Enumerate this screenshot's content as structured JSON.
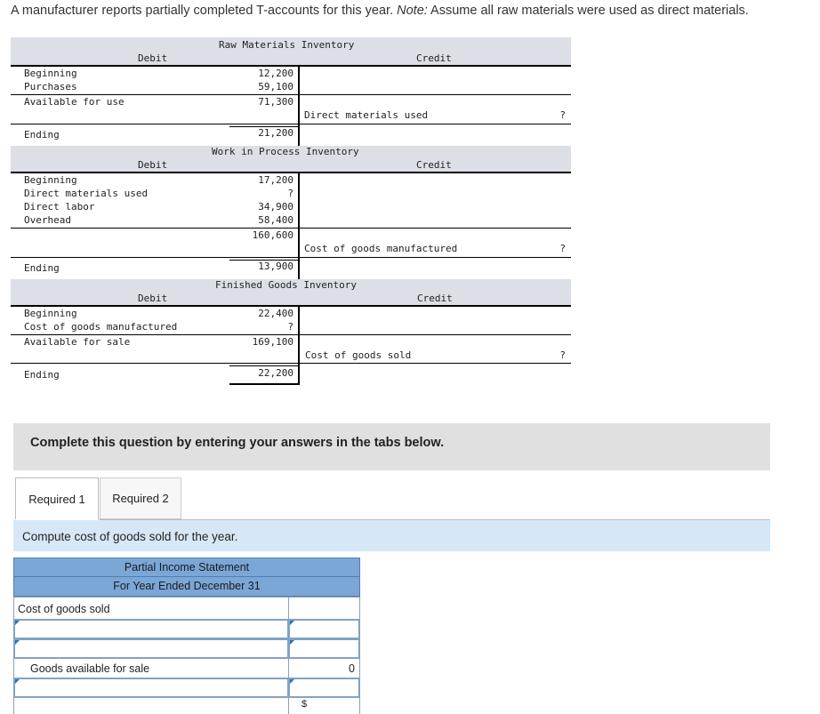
{
  "intro": {
    "text": "A manufacturer reports partially completed T-accounts for this year.",
    "note_label": "Note:",
    "note_text": "Assume all raw materials were used as direct materials."
  },
  "raw_materials": {
    "title": "Raw Materials Inventory",
    "debit_label": "Debit",
    "credit_label": "Credit",
    "rows": [
      {
        "label": "Beginning",
        "value": "12,200"
      },
      {
        "label": "Purchases",
        "value": "59,100"
      },
      {
        "label": "Available for use",
        "value": "71,300"
      }
    ],
    "credit_entry": {
      "label": "Direct materials used",
      "value": "?"
    },
    "ending": {
      "label": "Ending",
      "value": "21,200"
    }
  },
  "work_in_process": {
    "title": "Work in Process Inventory",
    "debit_label": "Debit",
    "credit_label": "Credit",
    "rows": [
      {
        "label": "Beginning",
        "value": "17,200"
      },
      {
        "label": "Direct materials used",
        "value": "?"
      },
      {
        "label": "Direct labor",
        "value": "34,900"
      },
      {
        "label": "Overhead",
        "value": "58,400"
      }
    ],
    "total": "160,600",
    "credit_entry": {
      "label": "Cost of goods manufactured",
      "value": "?"
    },
    "ending": {
      "label": "Ending",
      "value": "13,900"
    }
  },
  "finished_goods": {
    "title": "Finished Goods Inventory",
    "debit_label": "Debit",
    "credit_label": "Credit",
    "rows": [
      {
        "label": "Beginning",
        "value": "22,400"
      },
      {
        "label": "Cost of goods manufactured",
        "value": "?"
      },
      {
        "label": "Available for sale",
        "value": "169,100"
      }
    ],
    "credit_entry": {
      "label": "Cost of goods sold",
      "value": "?"
    },
    "ending": {
      "label": "Ending",
      "value": "22,200"
    }
  },
  "question": {
    "text": "Complete this question by entering your answers in the tabs below."
  },
  "tabs": [
    {
      "label": "Required 1",
      "active": true
    },
    {
      "label": "Required 2",
      "active": false
    }
  ],
  "instruction": "Compute cost of goods sold for the year.",
  "statement": {
    "title": "Partial Income Statement",
    "subtitle": "For Year Ended December 31",
    "row_cogs": "Cost of goods sold",
    "row_available": "Goods available for sale",
    "available_value": "0",
    "currency_symbol": "$"
  },
  "colors": {
    "band": "#dcdfe6",
    "statement_header": "#7ba7d7",
    "instruction_bg": "#d6e8f7",
    "input_border": "#7fa3c6"
  }
}
